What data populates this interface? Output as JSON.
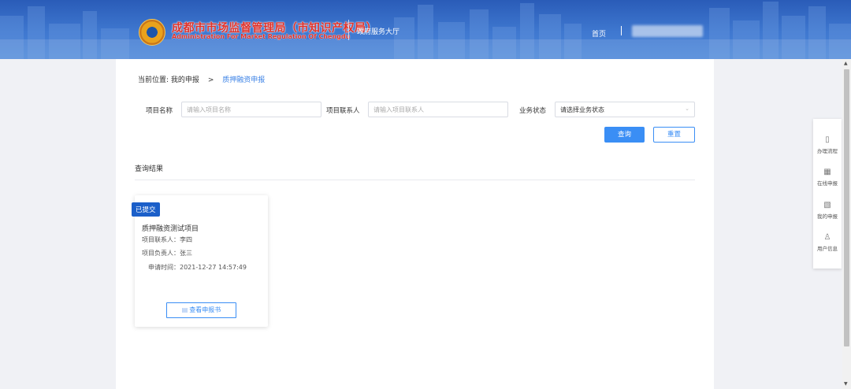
{
  "header": {
    "org_name_cn": "成都市市场监督管理局（市知识产权局）",
    "org_name_en": "Administration For Market Regulation Of Chengdu",
    "hall": "政府服务大厅",
    "nav_home": "首页"
  },
  "breadcrumb": {
    "prefix": "当前位置:",
    "parent": "我的申报",
    "separator": ">",
    "current": "质押融资申报"
  },
  "search": {
    "project_name_label": "项目名称",
    "project_name_placeholder": "请输入项目名称",
    "contact_label": "项目联系人",
    "contact_placeholder": "请输入项目联系人",
    "status_label": "业务状态",
    "status_value": "请选择业务状态",
    "query_button": "查询",
    "reset_button": "重置"
  },
  "results": {
    "title": "查询结果",
    "cards": [
      {
        "badge": "已提交",
        "title": "质押融资测试项目",
        "contact": "项目联系人：李四",
        "owner": "项目负责人：张三",
        "time": "申请时间：2021-12-27 14:57:49",
        "view_button": "查看申报书"
      }
    ]
  },
  "sidebar": {
    "items": [
      {
        "label": "办理流程",
        "icon": "document-icon"
      },
      {
        "label": "在线申报",
        "icon": "form-icon"
      },
      {
        "label": "我的申报",
        "icon": "edit-document-icon"
      },
      {
        "label": "用户信息",
        "icon": "user-icon"
      }
    ]
  },
  "colors": {
    "header_blue": "#3f78d0",
    "accent": "#3a8ef5",
    "badge": "#1b5fc9",
    "logo_red": "#e0322a"
  }
}
